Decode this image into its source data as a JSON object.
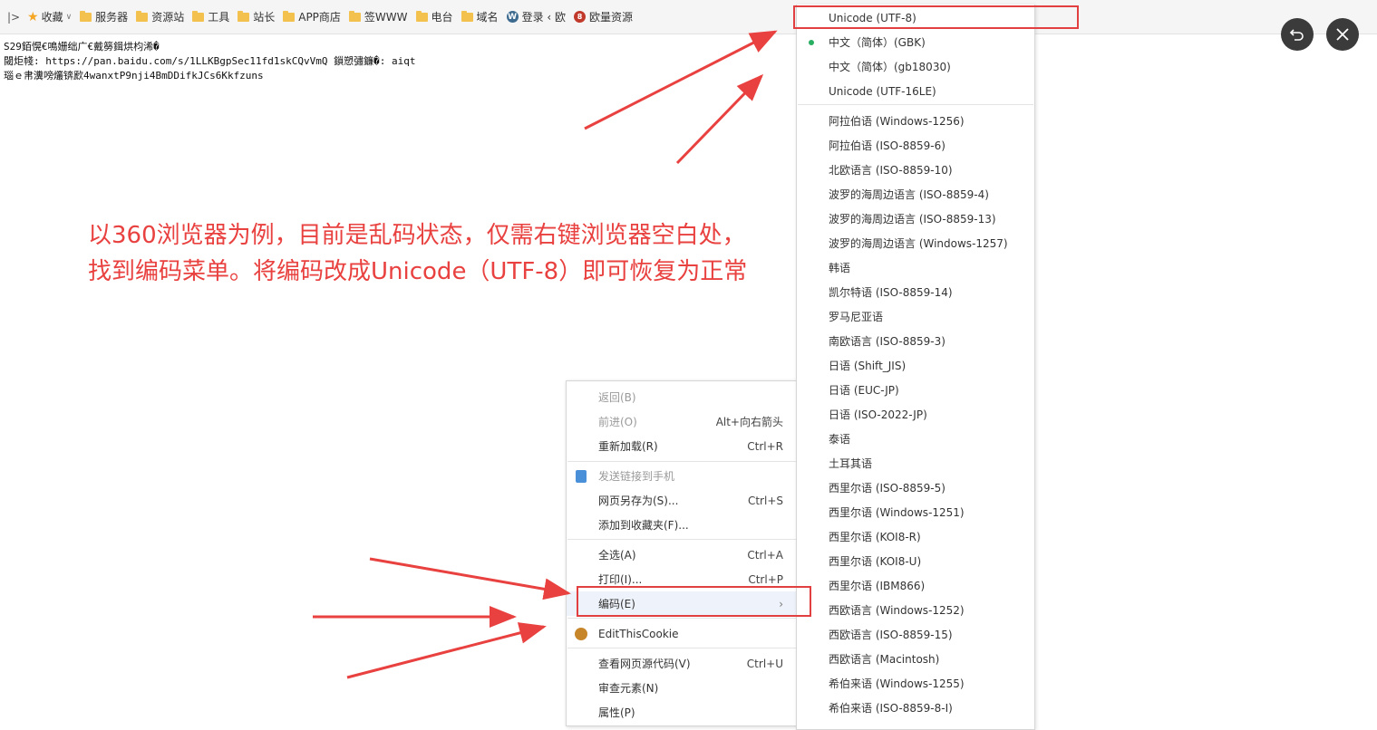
{
  "bookmarks": {
    "toggle_icon": "sidebar-toggle-icon",
    "favorites_label": "收藏",
    "items": [
      "服务器",
      "资源站",
      "工具",
      "站长",
      "APP商店",
      "签WWW",
      "电台",
      "域名"
    ],
    "wp_label": "登录 ‹ 欧",
    "ouliang_label": "欧量资源"
  },
  "page": {
    "garbled_lines": [
      "S29銆愰€鳴姗绌广€戴簩鍓烘枃浠�",
      "閾炬帴: https://pan.baidu.com/s/1LLKBgpSec11fd1skCQvVmQ 鎻愬彇鐮�: aiqt",
      "瑙ｅ帇瀵嗙爜锛歋4wanxtP9nji4BmDDifkJCs6Kkfzuns"
    ]
  },
  "annotation": {
    "line1": "以360浏览器为例，目前是乱码状态，仅需右键浏览器空白处，",
    "line2": "找到编码菜单。将编码改成Unicode（UTF-8）即可恢复为正常"
  },
  "context_menu": {
    "back": {
      "label": "返回(B)"
    },
    "forward": {
      "label": "前进(O)",
      "shortcut": "Alt+向右箭头"
    },
    "reload": {
      "label": "重新加载(R)",
      "shortcut": "Ctrl+R"
    },
    "send_to_phone": {
      "label": "发送链接到手机"
    },
    "save_as": {
      "label": "网页另存为(S)...",
      "shortcut": "Ctrl+S"
    },
    "add_favorite": {
      "label": "添加到收藏夹(F)..."
    },
    "select_all": {
      "label": "全选(A)",
      "shortcut": "Ctrl+A"
    },
    "print": {
      "label": "打印(I)...",
      "shortcut": "Ctrl+P"
    },
    "encoding": {
      "label": "编码(E)",
      "arrow": "›"
    },
    "editthiscookie": {
      "label": "EditThisCookie"
    },
    "view_source": {
      "label": "查看网页源代码(V)",
      "shortcut": "Ctrl+U"
    },
    "inspect": {
      "label": "审查元素(N)"
    },
    "properties": {
      "label": "属性(P)"
    }
  },
  "encoding_menu": {
    "top": [
      "Unicode (UTF-8)",
      "中文（简体）(GBK)",
      "中文（简体）(gb18030)",
      "Unicode (UTF-16LE)"
    ],
    "selected_index": 1,
    "others": [
      "阿拉伯语 (Windows-1256)",
      "阿拉伯语 (ISO-8859-6)",
      "北欧语言 (ISO-8859-10)",
      "波罗的海周边语言 (ISO-8859-4)",
      "波罗的海周边语言 (ISO-8859-13)",
      "波罗的海周边语言 (Windows-1257)",
      "韩语",
      "凯尔特语 (ISO-8859-14)",
      "罗马尼亚语",
      "南欧语言 (ISO-8859-3)",
      "日语 (Shift_JIS)",
      "日语 (EUC-JP)",
      "日语 (ISO-2022-JP)",
      "泰语",
      "土耳其语",
      "西里尔语 (ISO-8859-5)",
      "西里尔语 (Windows-1251)",
      "西里尔语 (KOI8-R)",
      "西里尔语 (KOI8-U)",
      "西里尔语 (IBM866)",
      "西欧语言 (Windows-1252)",
      "西欧语言 (ISO-8859-15)",
      "西欧语言 (Macintosh)",
      "希伯来语 (Windows-1255)",
      "希伯来语 (ISO-8859-8-I)"
    ]
  },
  "colors": {
    "annotation": "#e8413f",
    "selected_dot": "#27ae60"
  }
}
